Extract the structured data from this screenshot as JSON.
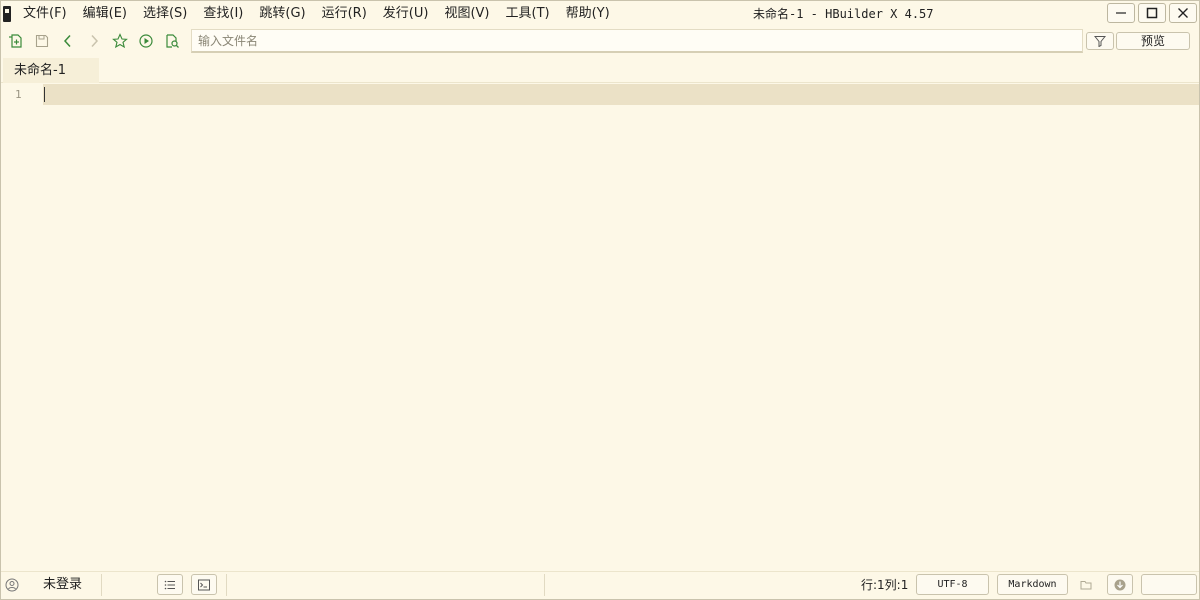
{
  "titlebar": {
    "menu": [
      {
        "label": "文件(F)"
      },
      {
        "label": "编辑(E)"
      },
      {
        "label": "选择(S)"
      },
      {
        "label": "查找(I)"
      },
      {
        "label": "跳转(G)"
      },
      {
        "label": "运行(R)"
      },
      {
        "label": "发行(U)"
      },
      {
        "label": "视图(V)"
      },
      {
        "label": "工具(T)"
      },
      {
        "label": "帮助(Y)"
      }
    ],
    "title": "未命名-1 - HBuilder X 4.57"
  },
  "toolbar": {
    "icons": [
      "new-file-icon",
      "save-icon",
      "back-icon",
      "forward-icon",
      "star-icon",
      "run-icon",
      "browser-preview-icon"
    ],
    "file_input_placeholder": "输入文件名",
    "file_input_value": "",
    "preview_label": "预览"
  },
  "tabs": [
    {
      "label": "未命名-1",
      "active": true
    }
  ],
  "editor": {
    "line_numbers": [
      "1"
    ],
    "content": ""
  },
  "statusbar": {
    "login_label": "未登录",
    "position": "行:1列:1",
    "encoding": "UTF-8",
    "language": "Markdown"
  },
  "colors": {
    "background": "#fdf8e7",
    "current_line": "#ebe1c6",
    "accent_green": "#3a8a3a"
  }
}
